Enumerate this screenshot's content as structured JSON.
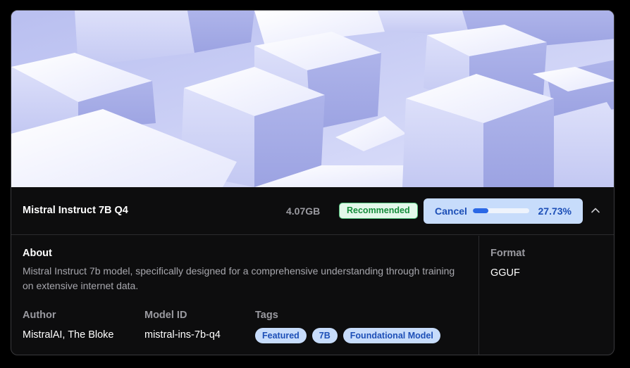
{
  "model": {
    "name": "Mistral Instruct 7B Q4",
    "size": "4.07GB",
    "badge": "Recommended"
  },
  "download": {
    "cancel_label": "Cancel",
    "progress_percent": 27.73,
    "progress_text": "27.73%"
  },
  "about": {
    "title": "About",
    "description": "Mistral Instruct 7b model, specifically designed for a comprehensive understanding through training on extensive internet data."
  },
  "meta": {
    "author_label": "Author",
    "author_value": "MistralAI, The Bloke",
    "model_id_label": "Model ID",
    "model_id_value": "mistral-ins-7b-q4",
    "tags_label": "Tags",
    "tags": [
      "Featured",
      "7B",
      "Foundational Model"
    ]
  },
  "format": {
    "title": "Format",
    "value": "GGUF"
  },
  "colors": {
    "accent": "#2b68e6",
    "accent_bg": "#c7dcfb",
    "recommended_text": "#168d3b",
    "recommended_bg": "#e3f8ea"
  },
  "icons": {
    "collapse": "chevron-up-icon"
  }
}
